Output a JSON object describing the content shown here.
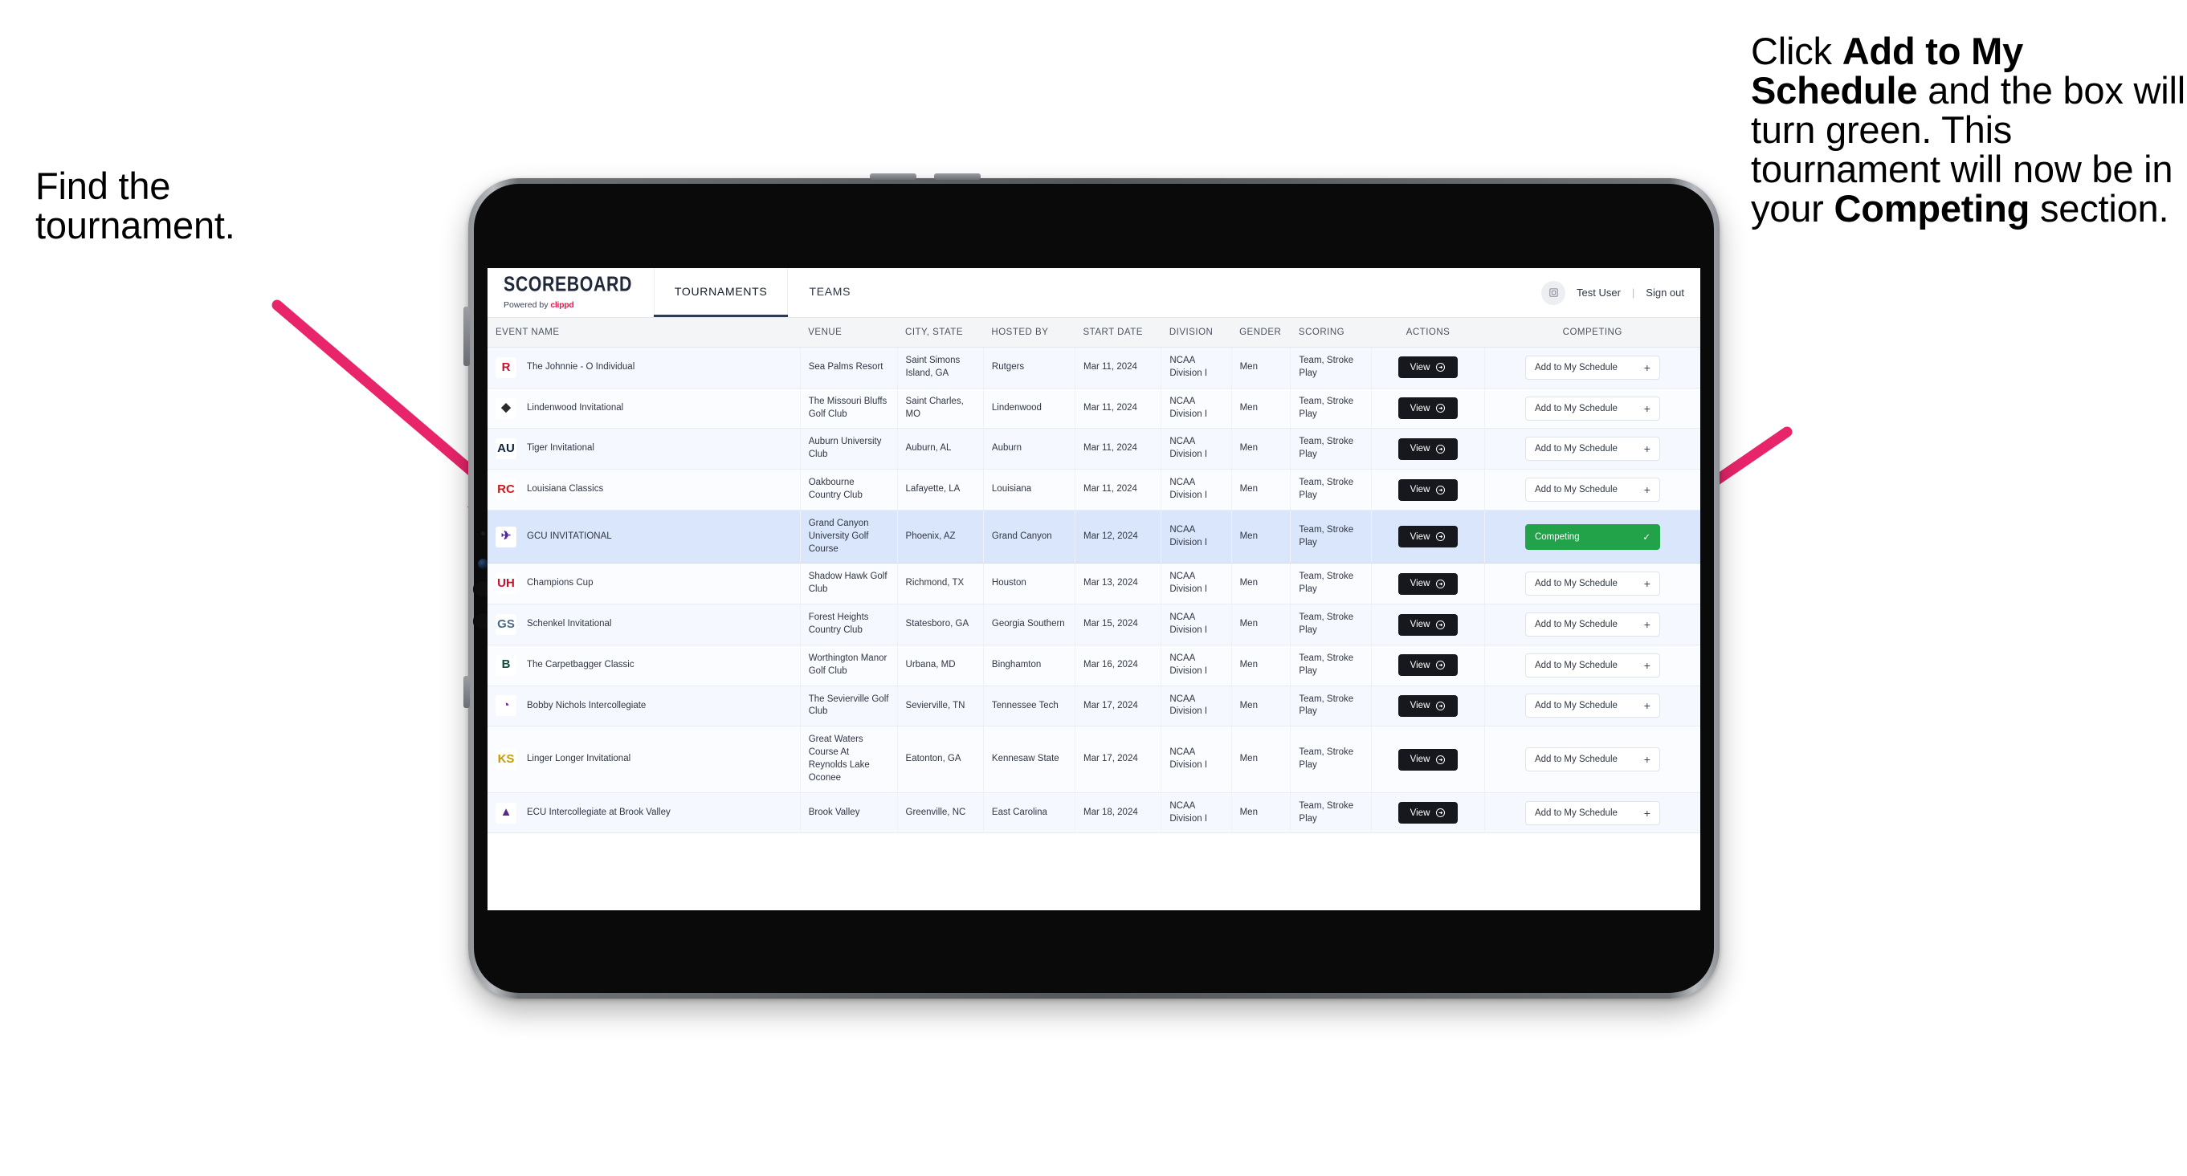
{
  "annotations": {
    "left": {
      "line1": "Find the",
      "line2": "tournament."
    },
    "right": {
      "p1_pre": "Click ",
      "p1_bold": "Add to My Schedule",
      "p1_post": " and the box will turn green. This tournament will now be in your ",
      "p2_bold": "Competing",
      "p2_post": " section."
    }
  },
  "app": {
    "logo": {
      "title": "SCOREBOARD",
      "powered_prefix": "Powered by ",
      "brand": "clippd"
    },
    "nav": [
      {
        "label": "TOURNAMENTS",
        "active": true
      },
      {
        "label": "TEAMS",
        "active": false
      }
    ],
    "account": {
      "avatar_icon": "user-avatar-icon",
      "user": "Test User",
      "separator": "|",
      "sign_out": "Sign out"
    }
  },
  "table": {
    "columns": [
      "EVENT NAME",
      "VENUE",
      "CITY, STATE",
      "HOSTED BY",
      "START DATE",
      "DIVISION",
      "GENDER",
      "SCORING",
      "ACTIONS",
      "COMPETING"
    ],
    "view_label": "View",
    "add_label": "Add to My Schedule",
    "add_plus": "+",
    "competing_label": "Competing",
    "competing_check": "✓",
    "rows": [
      {
        "event": "The Johnnie - O Individual",
        "badge": {
          "text": "R",
          "bg": "#ffffff",
          "fg": "#c8102e"
        },
        "venue": "Sea Palms Resort",
        "city": "Saint Simons Island, GA",
        "host": "Rutgers",
        "date": "Mar 11, 2024",
        "division": "NCAA Division I",
        "gender": "Men",
        "scoring": "Team, Stroke Play",
        "competing": false
      },
      {
        "event": "Lindenwood Invitational",
        "badge": {
          "text": "◆",
          "bg": "#ffffff",
          "fg": "#2b2b2b"
        },
        "venue": "The Missouri Bluffs Golf Club",
        "city": "Saint Charles, MO",
        "host": "Lindenwood",
        "date": "Mar 11, 2024",
        "division": "NCAA Division I",
        "gender": "Men",
        "scoring": "Team, Stroke Play",
        "competing": false
      },
      {
        "event": "Tiger Invitational",
        "badge": {
          "text": "AU",
          "bg": "#ffffff",
          "fg": "#0c2340"
        },
        "venue": "Auburn University Club",
        "city": "Auburn, AL",
        "host": "Auburn",
        "date": "Mar 11, 2024",
        "division": "NCAA Division I",
        "gender": "Men",
        "scoring": "Team, Stroke Play",
        "competing": false
      },
      {
        "event": "Louisiana Classics",
        "badge": {
          "text": "RC",
          "bg": "#ffffff",
          "fg": "#ce181e"
        },
        "venue": "Oakbourne Country Club",
        "city": "Lafayette, LA",
        "host": "Louisiana",
        "date": "Mar 11, 2024",
        "division": "NCAA Division I",
        "gender": "Men",
        "scoring": "Team, Stroke Play",
        "competing": false
      },
      {
        "event": "GCU INVITATIONAL",
        "badge": {
          "text": "✈",
          "bg": "#ffffff",
          "fg": "#522398"
        },
        "venue": "Grand Canyon University Golf Course",
        "city": "Phoenix, AZ",
        "host": "Grand Canyon",
        "date": "Mar 12, 2024",
        "division": "NCAA Division I",
        "gender": "Men",
        "scoring": "Team, Stroke Play",
        "competing": true,
        "selected": true
      },
      {
        "event": "Champions Cup",
        "badge": {
          "text": "UH",
          "bg": "#ffffff",
          "fg": "#c8102e"
        },
        "venue": "Shadow Hawk Golf Club",
        "city": "Richmond, TX",
        "host": "Houston",
        "date": "Mar 13, 2024",
        "division": "NCAA Division I",
        "gender": "Men",
        "scoring": "Team, Stroke Play",
        "competing": false
      },
      {
        "event": "Schenkel Invitational",
        "badge": {
          "text": "GS",
          "bg": "#ffffff",
          "fg": "#4a6b86"
        },
        "venue": "Forest Heights Country Club",
        "city": "Statesboro, GA",
        "host": "Georgia Southern",
        "date": "Mar 15, 2024",
        "division": "NCAA Division I",
        "gender": "Men",
        "scoring": "Team, Stroke Play",
        "competing": false
      },
      {
        "event": "The Carpetbagger Classic",
        "badge": {
          "text": "B",
          "bg": "#ffffff",
          "fg": "#0f4c3a"
        },
        "venue": "Worthington Manor Golf Club",
        "city": "Urbana, MD",
        "host": "Binghamton",
        "date": "Mar 16, 2024",
        "division": "NCAA Division I",
        "gender": "Men",
        "scoring": "Team, Stroke Play",
        "competing": false
      },
      {
        "event": "Bobby Nichols Intercollegiate",
        "badge": {
          "text": "◔",
          "bg": "#ffffff",
          "fg": "#6b2d8f"
        },
        "venue": "The Sevierville Golf Club",
        "city": "Sevierville, TN",
        "host": "Tennessee Tech",
        "date": "Mar 17, 2024",
        "division": "NCAA Division I",
        "gender": "Men",
        "scoring": "Team, Stroke Play",
        "competing": false
      },
      {
        "event": "Linger Longer Invitational",
        "badge": {
          "text": "KS",
          "bg": "#ffffff",
          "fg": "#cc9900"
        },
        "venue": "Great Waters Course At Reynolds Lake Oconee",
        "city": "Eatonton, GA",
        "host": "Kennesaw State",
        "date": "Mar 17, 2024",
        "division": "NCAA Division I",
        "gender": "Men",
        "scoring": "Team, Stroke Play",
        "competing": false
      },
      {
        "event": "ECU Intercollegiate at Brook Valley",
        "badge": {
          "text": "▲",
          "bg": "#ffffff",
          "fg": "#592a8a"
        },
        "venue": "Brook Valley",
        "city": "Greenville, NC",
        "host": "East Carolina",
        "date": "Mar 18, 2024",
        "division": "NCAA Division I",
        "gender": "Men",
        "scoring": "Team, Stroke Play",
        "competing": false,
        "clipped": true
      }
    ]
  },
  "colors": {
    "accent_pink": "#e8246b",
    "competing_green": "#22a34a",
    "brand_red": "#e8174a",
    "selected_row": "#d9e6fb"
  }
}
